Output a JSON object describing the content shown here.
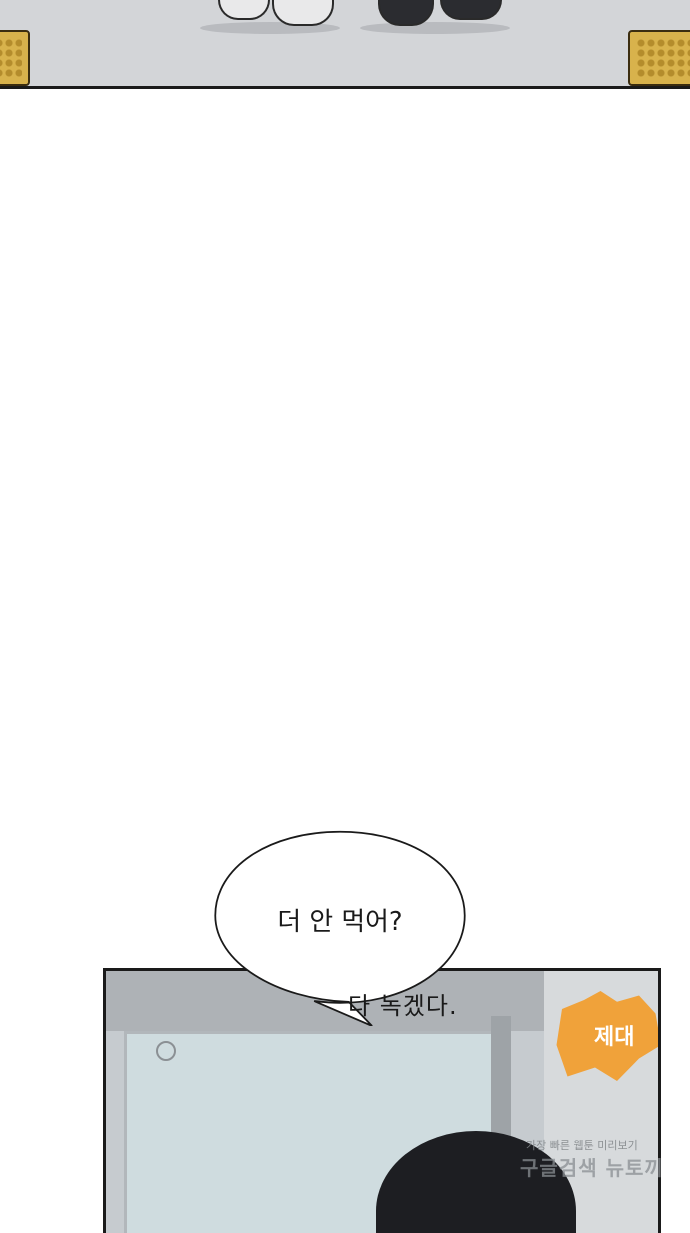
{
  "panels": {
    "top": {
      "description_name": "floor-scene"
    },
    "bottom": {
      "poster_text": "제대"
    }
  },
  "speech_bubble": {
    "line1": "더 안 먹어?",
    "line2": "다 녹겠다."
  },
  "watermark": {
    "line1": "가장 빠른 웹툰 미리보기",
    "line2": "구글검색 뉴토끼"
  }
}
